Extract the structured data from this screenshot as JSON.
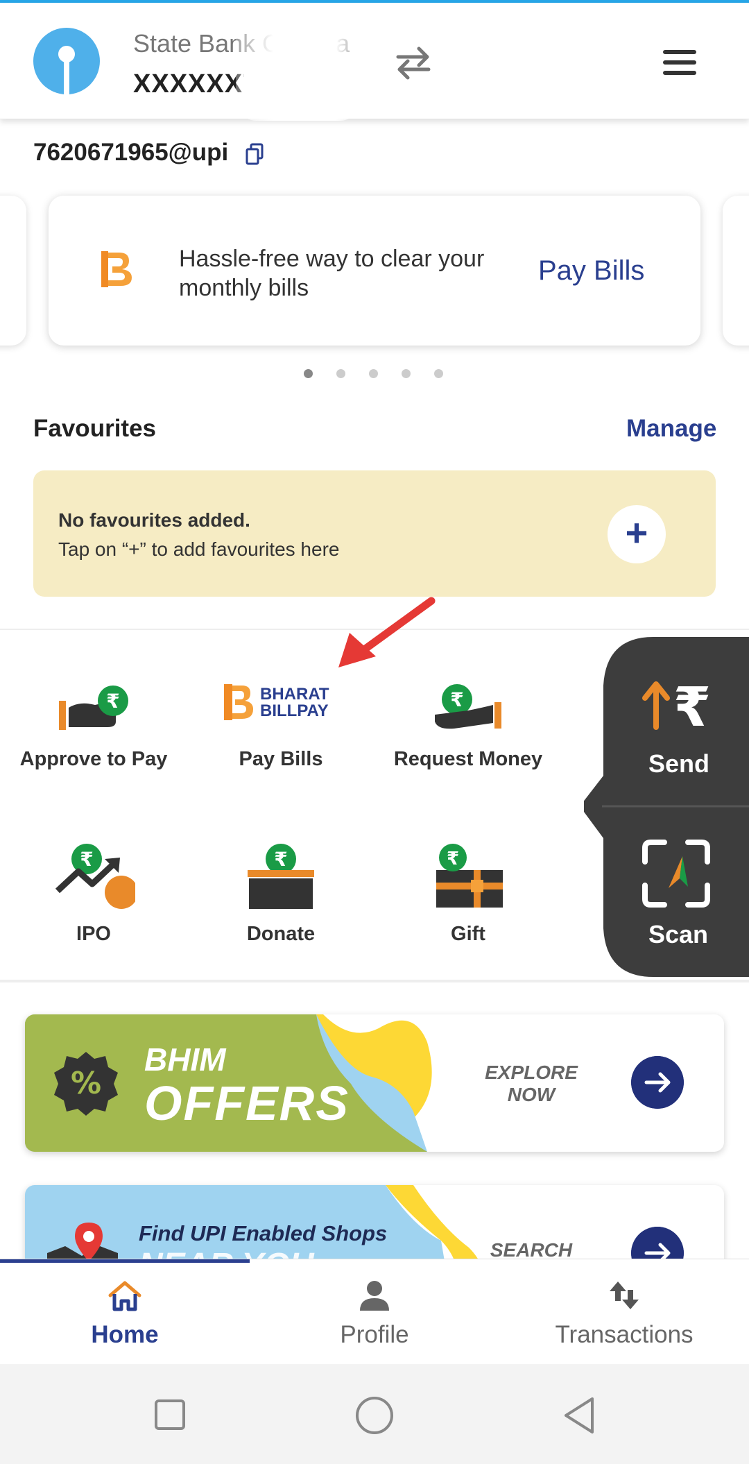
{
  "header": {
    "bank_name": "State Bank Of India",
    "account_masked": "XXXXXX7",
    "upi_id": "7620671965@upi"
  },
  "carousel": {
    "text": "Hassle-free way to clear your monthly bills",
    "link": "Pay Bills",
    "pages": 5,
    "active_page": 1
  },
  "favourites": {
    "title": "Favourites",
    "manage_label": "Manage",
    "empty_title": "No favourites added.",
    "empty_hint": "Tap on “+” to add favourites here",
    "add_label": "+"
  },
  "quick_actions": [
    {
      "label": "Approve to Pay",
      "icon": "approve-to-pay-icon"
    },
    {
      "label": "Pay Bills",
      "icon": "bharat-billpay-icon"
    },
    {
      "label": "Request Money",
      "icon": "request-money-icon"
    },
    {
      "label": "IPO",
      "icon": "ipo-icon"
    },
    {
      "label": "Donate",
      "icon": "donate-icon"
    },
    {
      "label": "Gift",
      "icon": "gift-icon"
    }
  ],
  "billpay_logo": {
    "line1": "BHARAT",
    "line2": "BILLPAY"
  },
  "fab": {
    "send_label": "Send",
    "scan_label": "Scan",
    "rupee": "₹"
  },
  "banners": [
    {
      "line1": "BHIM",
      "line2": "OFFERS",
      "cta": "EXPLORE NOW"
    },
    {
      "line1": "Find UPI Enabled Shops",
      "line2": "NEAR YOU",
      "cta": "SEARCH NOW"
    }
  ],
  "bottom_nav": [
    {
      "label": "Home",
      "active": true
    },
    {
      "label": "Profile",
      "active": false
    },
    {
      "label": "Transactions",
      "active": false
    }
  ],
  "colors": {
    "brand_blue": "#2a3f8f",
    "sbi_blue": "#4fb0ea",
    "accent_orange": "#e98a2a",
    "fav_bg": "#f6ecc4",
    "fab_dark": "#3d3d3d",
    "offers_green": "#a3b94f"
  }
}
